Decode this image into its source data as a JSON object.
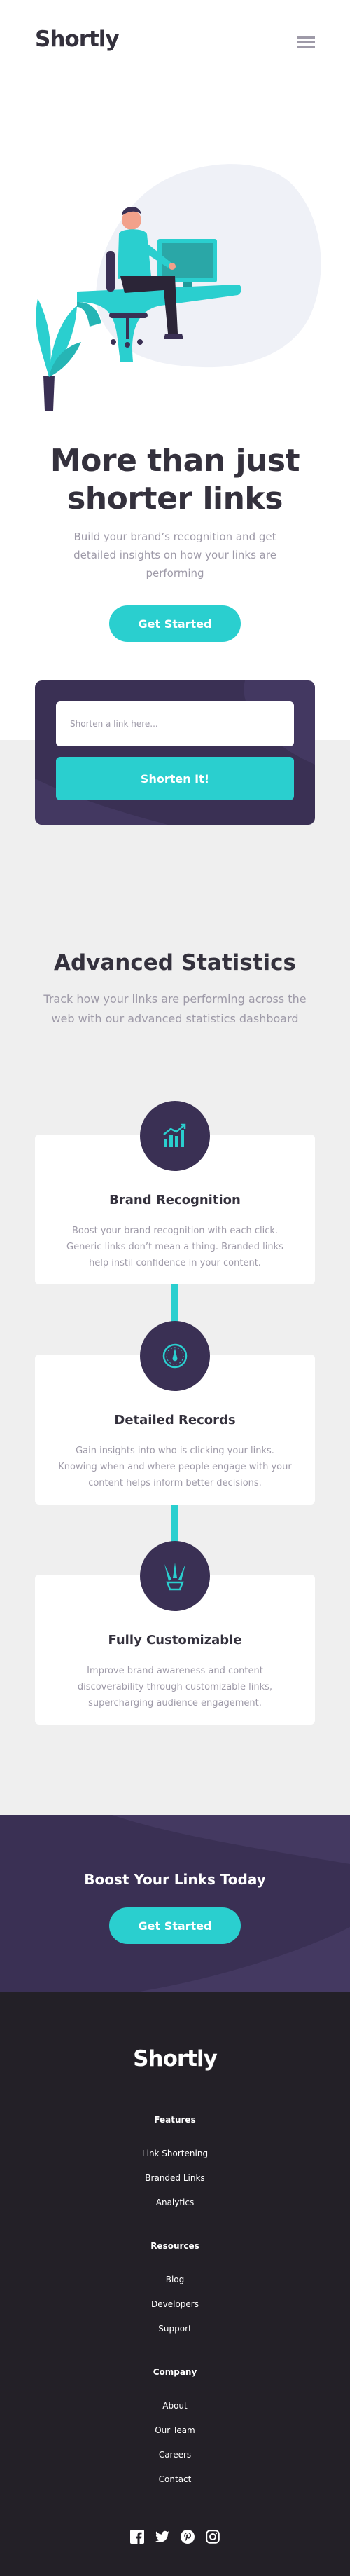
{
  "brand": {
    "name": "Shortly"
  },
  "colors": {
    "cyan": "#2acfcf",
    "dark_violet": "#3a3054",
    "grayish_violet": "#9e9aa8",
    "very_dark_violet": "#232027",
    "light_gray": "#efefef"
  },
  "header": {
    "menu_icon": "hamburger-menu-icon"
  },
  "hero": {
    "title": "More than just shorter links",
    "subtitle": "Build your brand’s recognition and get detailed insights on how your links are performing",
    "cta_label": "Get Started"
  },
  "shorten": {
    "placeholder": "Shorten a link here...",
    "button_label": "Shorten It!"
  },
  "stats": {
    "title": "Advanced Statistics",
    "subtitle": "Track how your links are performing across the web with our advanced statistics dashboard",
    "cards": [
      {
        "icon": "brand-recognition-icon",
        "title": "Brand Recognition",
        "text": "Boost your brand recognition with each click. Generic links don’t mean a thing. Branded links help instil confidence in your content."
      },
      {
        "icon": "detailed-records-icon",
        "title": "Detailed Records",
        "text": "Gain insights into who is clicking your links. Knowing when and where people engage with your content helps inform better decisions."
      },
      {
        "icon": "fully-customizable-icon",
        "title": "Fully Customizable",
        "text": "Improve brand awareness and content discoverability through customizable links, supercharging audience engagement."
      }
    ]
  },
  "boost": {
    "title": "Boost Your Links Today",
    "cta_label": "Get Started"
  },
  "footer": {
    "logo": "Shortly",
    "columns": [
      {
        "heading": "Features",
        "links": [
          "Link Shortening",
          "Branded Links",
          "Analytics"
        ]
      },
      {
        "heading": "Resources",
        "links": [
          "Blog",
          "Developers",
          "Support"
        ]
      },
      {
        "heading": "Company",
        "links": [
          "About",
          "Our Team",
          "Careers",
          "Contact"
        ]
      }
    ],
    "socials": [
      "facebook-icon",
      "twitter-icon",
      "pinterest-icon",
      "instagram-icon"
    ]
  }
}
